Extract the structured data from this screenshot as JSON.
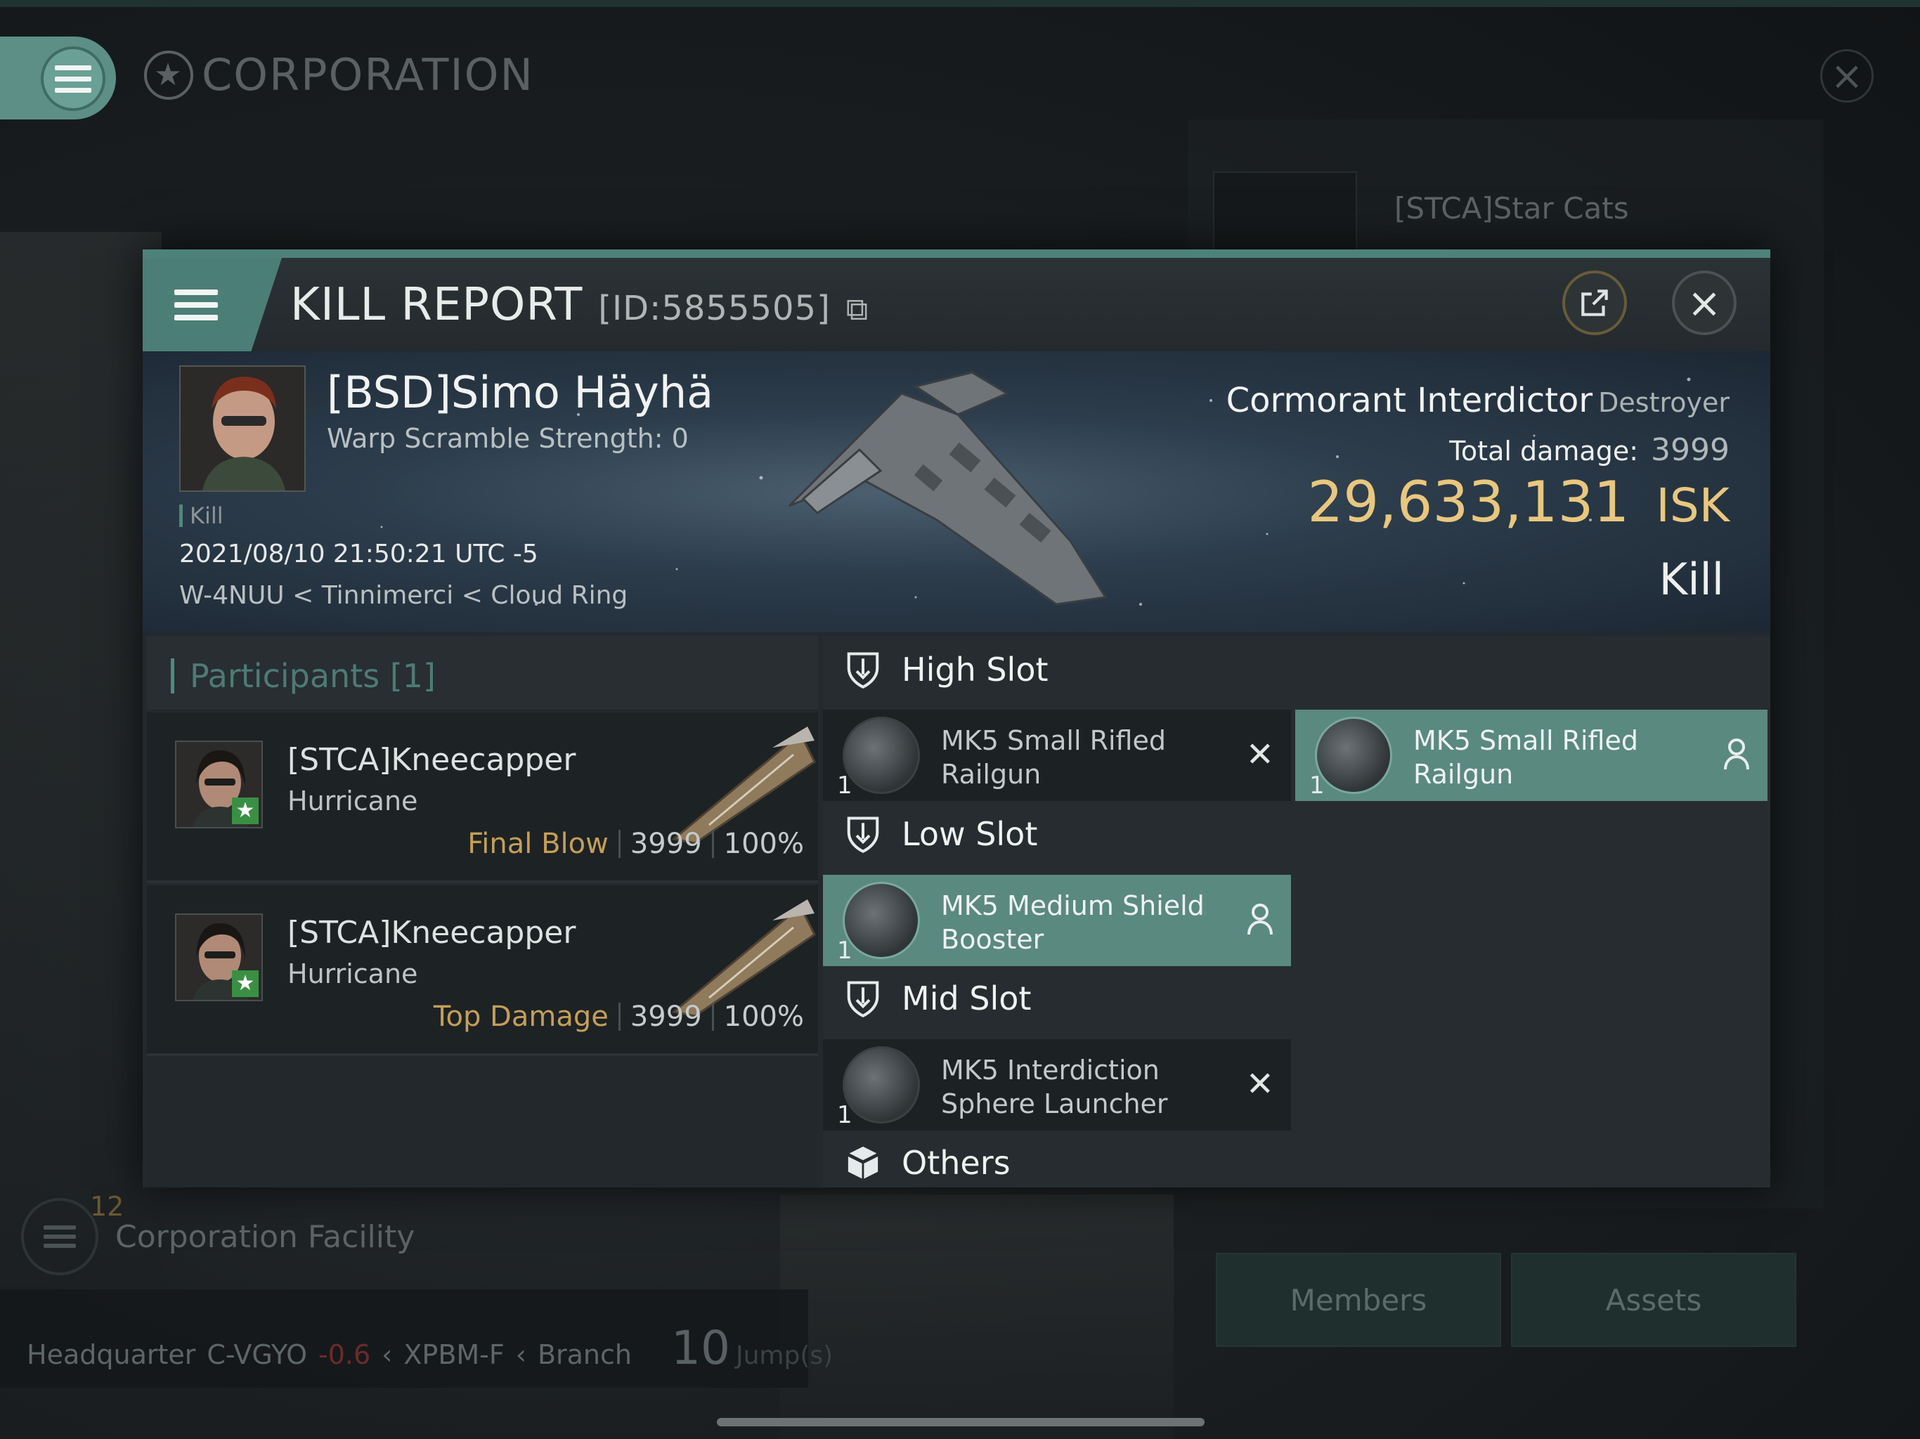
{
  "background": {
    "screen_title": "CORPORATION",
    "corp_name": "[STCA]Star Cats",
    "facility_badge": "12",
    "facility_label": "Corporation Facility",
    "hq": {
      "label": "Headquarter",
      "system": "C-VGYO",
      "security": "-0.6",
      "constellation": "XPBM-F",
      "region": "Branch",
      "jumps": "10",
      "jumps_label": "Jump(s)"
    },
    "buttons": [
      "Members",
      "Assets"
    ]
  },
  "kill_report": {
    "title": "KILL REPORT",
    "id": "[ID:5855505]",
    "victim": {
      "name": "[BSD]Simo Häyhä",
      "warp_scramble": "Warp Scramble Strength: 0",
      "tag": "Kill",
      "datetime": "2021/08/10 21:50:21 UTC -5",
      "location": "W-4NUU < Tinnimerci < Cloud Ring"
    },
    "ship": {
      "name": "Cormorant Interdictor",
      "class": "Destroyer",
      "total_damage_label": "Total damage:",
      "total_damage": "3999",
      "isk_value": "29,633,131",
      "isk_unit": "ISK",
      "result": "Kill"
    },
    "participants": {
      "title": "Participants",
      "count": "[1]",
      "rows": [
        {
          "name": "[STCA]Kneecapper",
          "ship": "Hurricane",
          "label": "Final Blow",
          "damage": "3999",
          "percent": "100%"
        },
        {
          "name": "[STCA]Kneecapper",
          "ship": "Hurricane",
          "label": "Top Damage",
          "damage": "3999",
          "percent": "100%"
        }
      ]
    },
    "slots": {
      "high": {
        "title": "High Slot",
        "modules": [
          {
            "qty": "1",
            "name": "MK5 Small Rifled Railgun",
            "state": "destroyed"
          },
          {
            "qty": "1",
            "name": "MK5 Small Rifled Railgun",
            "state": "dropped"
          }
        ]
      },
      "low": {
        "title": "Low Slot",
        "modules": [
          {
            "qty": "1",
            "name": "MK5 Medium Shield Booster",
            "state": "dropped"
          }
        ]
      },
      "mid": {
        "title": "Mid Slot",
        "modules": [
          {
            "qty": "1",
            "name": "MK5 Interdiction Sphere Launcher",
            "state": "destroyed"
          }
        ]
      },
      "others": {
        "title": "Others"
      }
    }
  },
  "colors": {
    "accent": "#4d827a",
    "isk": "#e9c77e",
    "active_module": "#5a8980",
    "participant_label": "#c49f57"
  }
}
